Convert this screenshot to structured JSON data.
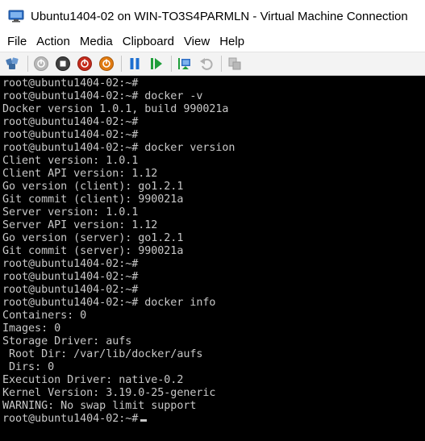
{
  "window": {
    "title": "Ubuntu1404-02 on WIN-TO3S4PARMLN - Virtual Machine Connection"
  },
  "menu": {
    "items": [
      "File",
      "Action",
      "Media",
      "Clipboard",
      "View",
      "Help"
    ]
  },
  "toolbar": {
    "buttons": [
      "ctrl-alt-del-icon",
      "start-icon",
      "turn-off-icon",
      "shut-down-icon",
      "save-icon",
      "pause-icon",
      "reset-icon",
      "checkpoint-icon",
      "revert-icon",
      "enhanced-session-icon"
    ],
    "colors": {
      "disabled": "#b0b0b0",
      "red": "#c42b1c",
      "orange": "#e07a10",
      "blue": "#1e6fd0",
      "green": "#1f9e3a"
    }
  },
  "terminal": {
    "lines": [
      "root@ubuntu1404-02:~#",
      "root@ubuntu1404-02:~# docker -v",
      "Docker version 1.0.1, build 990021a",
      "root@ubuntu1404-02:~#",
      "root@ubuntu1404-02:~#",
      "root@ubuntu1404-02:~# docker version",
      "Client version: 1.0.1",
      "Client API version: 1.12",
      "Go version (client): go1.2.1",
      "Git commit (client): 990021a",
      "Server version: 1.0.1",
      "Server API version: 1.12",
      "Go version (server): go1.2.1",
      "Git commit (server): 990021a",
      "root@ubuntu1404-02:~#",
      "root@ubuntu1404-02:~#",
      "root@ubuntu1404-02:~#",
      "root@ubuntu1404-02:~# docker info",
      "Containers: 0",
      "Images: 0",
      "Storage Driver: aufs",
      " Root Dir: /var/lib/docker/aufs",
      " Dirs: 0",
      "Execution Driver: native-0.2",
      "Kernel Version: 3.19.0-25-generic",
      "WARNING: No swap limit support",
      "root@ubuntu1404-02:~#"
    ]
  }
}
